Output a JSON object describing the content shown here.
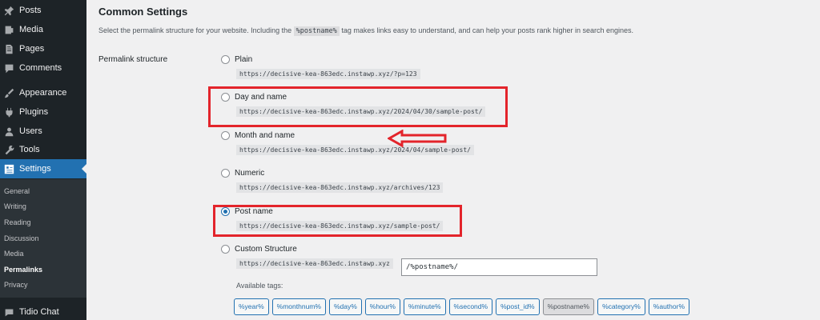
{
  "sidebar": {
    "items": [
      {
        "label": "Posts",
        "icon": "pin-icon"
      },
      {
        "label": "Media",
        "icon": "media-icon"
      },
      {
        "label": "Pages",
        "icon": "pages-icon"
      },
      {
        "label": "Comments",
        "icon": "comments-icon"
      },
      {
        "label": "Appearance",
        "icon": "appearance-icon"
      },
      {
        "label": "Plugins",
        "icon": "plugins-icon"
      },
      {
        "label": "Users",
        "icon": "users-icon"
      },
      {
        "label": "Tools",
        "icon": "tools-icon"
      },
      {
        "label": "Settings",
        "icon": "settings-icon"
      }
    ],
    "submenu": [
      "General",
      "Writing",
      "Reading",
      "Discussion",
      "Media",
      "Permalinks",
      "Privacy"
    ],
    "current_sub": "Permalinks",
    "bottom_item": {
      "label": "Tidio Chat",
      "icon": "chat-icon"
    }
  },
  "main": {
    "section_title": "Common Settings",
    "intro_before": "Select the permalink structure for your website. Including the ",
    "intro_code": "%postname%",
    "intro_after": " tag makes links easy to understand, and can help your posts rank higher in search engines.",
    "structure_label": "Permalink structure",
    "options": [
      {
        "label": "Plain",
        "sample": "https://decisive-kea-863edc.instawp.xyz/?p=123",
        "checked": false
      },
      {
        "label": "Day and name",
        "sample": "https://decisive-kea-863edc.instawp.xyz/2024/04/30/sample-post/",
        "checked": false
      },
      {
        "label": "Month and name",
        "sample": "https://decisive-kea-863edc.instawp.xyz/2024/04/sample-post/",
        "checked": false
      },
      {
        "label": "Numeric",
        "sample": "https://decisive-kea-863edc.instawp.xyz/archives/123",
        "checked": false
      },
      {
        "label": "Post name",
        "sample": "https://decisive-kea-863edc.instawp.xyz/sample-post/",
        "checked": true
      },
      {
        "label": "Custom Structure",
        "sample": "https://decisive-kea-863edc.instawp.xyz",
        "checked": false
      }
    ],
    "custom_value": "/%postname%/",
    "available_tags_label": "Available tags:",
    "tags": [
      "%year%",
      "%monthnum%",
      "%day%",
      "%hour%",
      "%minute%",
      "%second%",
      "%post_id%",
      "%postname%",
      "%category%",
      "%author%"
    ],
    "active_tag": "%postname%"
  },
  "colors": {
    "sidebar_bg": "#1d2327",
    "accent": "#2271b1",
    "highlight": "#e3242b"
  }
}
